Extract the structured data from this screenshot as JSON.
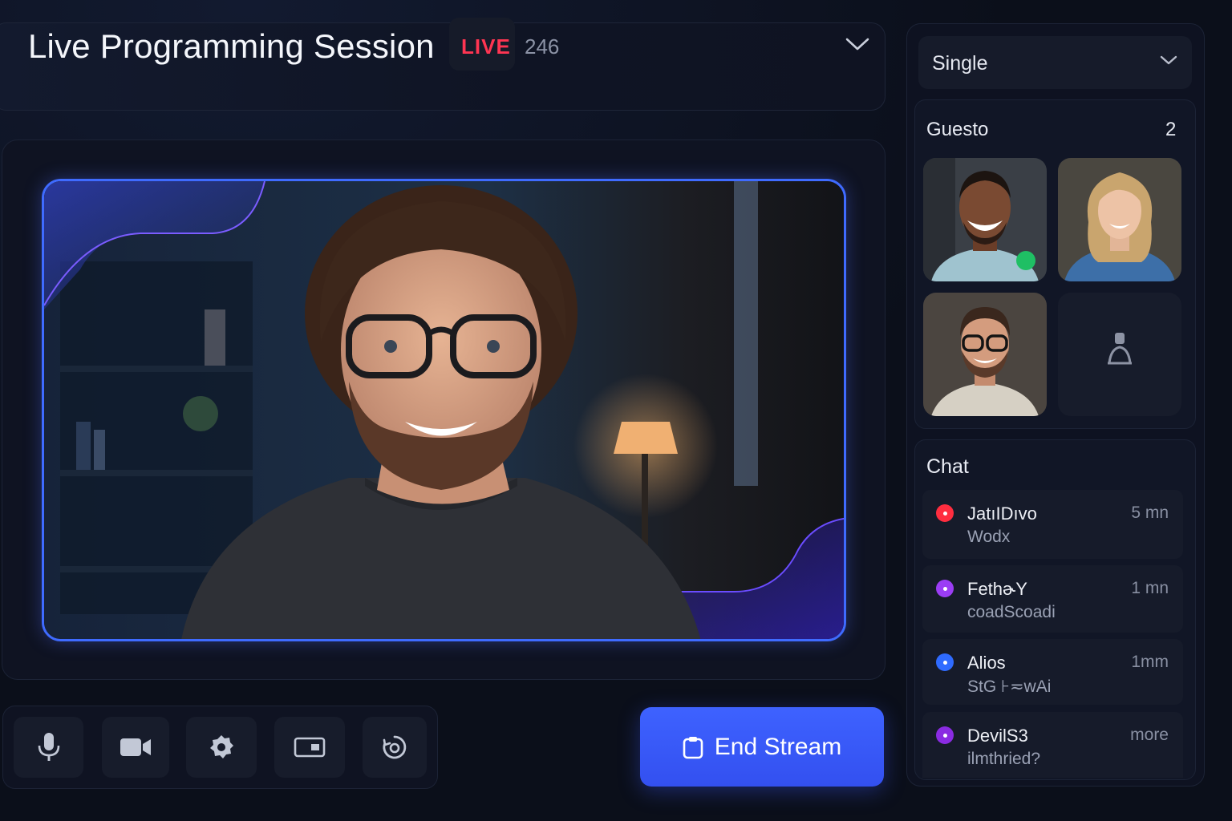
{
  "header": {
    "title": "Live Programming Session",
    "live_label": "LIVE",
    "viewer_count": "246",
    "menu_icon": "chevron-down-icon"
  },
  "video": {
    "accent_color": "#3f6bff"
  },
  "controls": {
    "buttons": [
      {
        "name": "microphone",
        "icon": "microphone-icon"
      },
      {
        "name": "camera",
        "icon": "video-camera-icon"
      },
      {
        "name": "settings",
        "icon": "gear-icon"
      },
      {
        "name": "screen-share",
        "icon": "screen-share-icon"
      },
      {
        "name": "record",
        "icon": "record-icon"
      }
    ],
    "end_stream_label": "End Stream",
    "end_stream_color": "#3e62ff"
  },
  "sidebar": {
    "layout_select": {
      "value": "Single"
    },
    "guests": {
      "title": "Guesto",
      "count": "2"
    },
    "chat": {
      "title": "Chat",
      "messages": [
        {
          "name": "JatıIDıvo",
          "time": "5 mn",
          "text": "Wodx",
          "color": "#ff2d3f"
        },
        {
          "name": "FethɚY",
          "time": "1 mn",
          "text": "coadScoadi",
          "color": "#9b3df5"
        },
        {
          "name": "Alios",
          "time": "1mm",
          "text": "StG ⊦≂wAi",
          "color": "#2f6bff"
        },
        {
          "name": "DevilS3",
          "time": "more",
          "text": "ilmthried?",
          "color": "#8a2be2"
        }
      ]
    }
  }
}
